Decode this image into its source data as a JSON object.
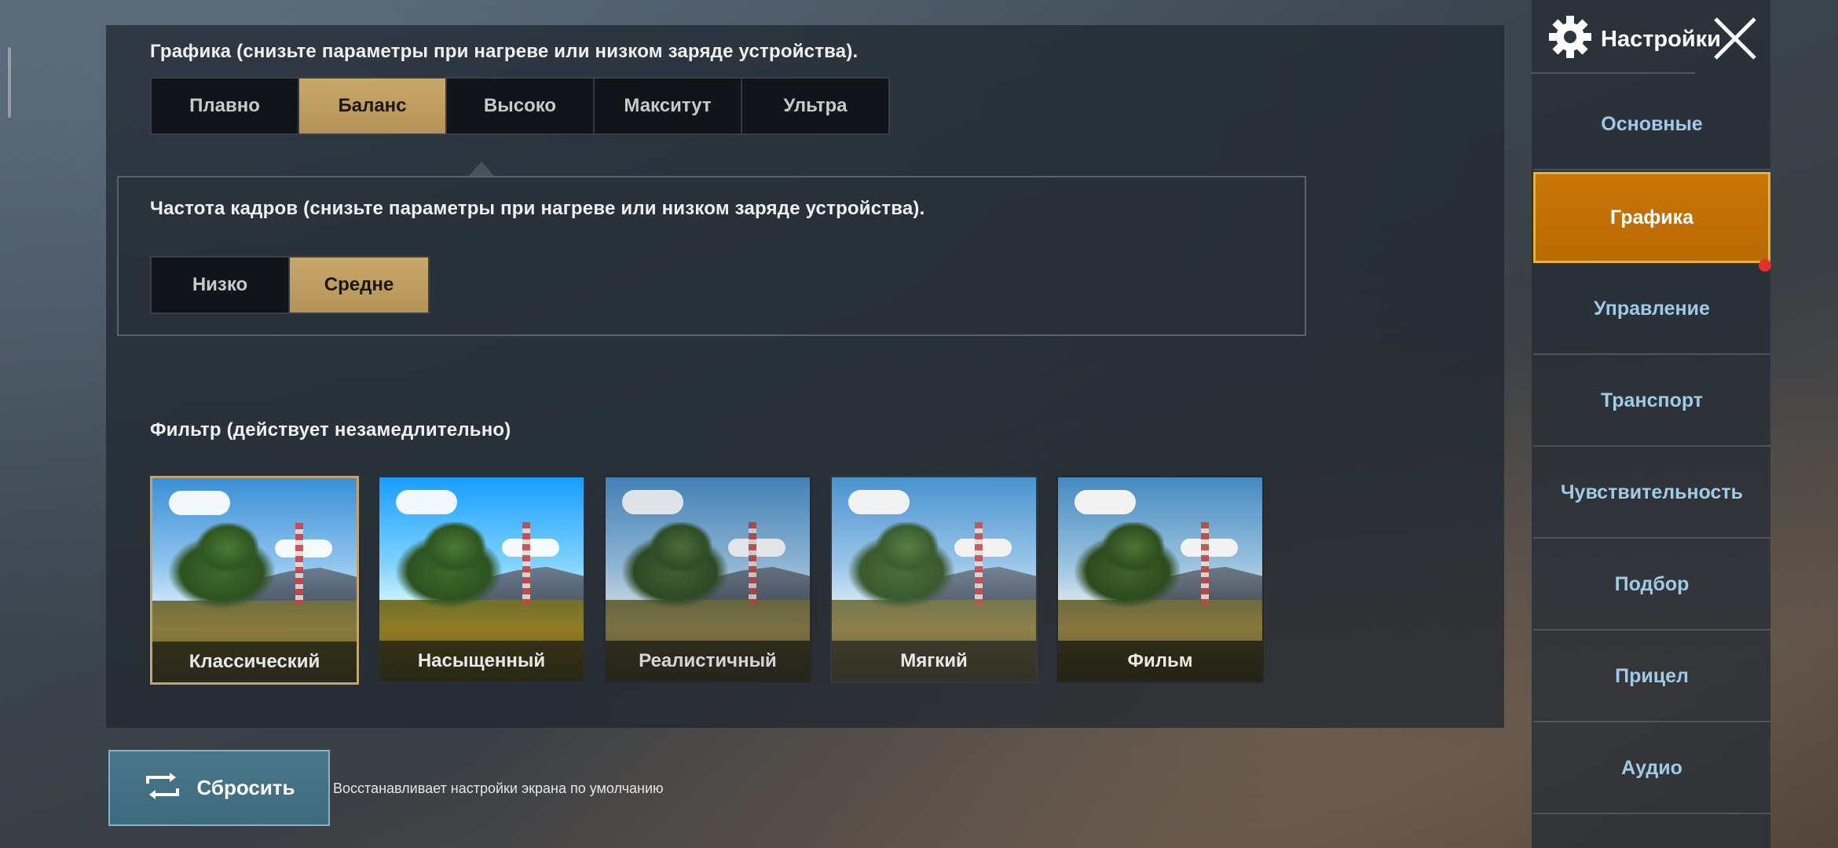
{
  "panel": {
    "graphics": {
      "title": "Графика (снизьте параметры при нагреве или низком заряде устройства).",
      "options": [
        "Плавно",
        "Баланс",
        "Высоко",
        "Макситут",
        "Ультра"
      ],
      "selected": "Баланс"
    },
    "framerate": {
      "title": "Частота кадров (снизьте параметры при нагреве или низком заряде устройства).",
      "options": [
        "Низко",
        "Средне"
      ],
      "selected": "Средне"
    },
    "filter": {
      "title": "Фильтр (действует незамедлительно)",
      "items": [
        "Классический",
        "Насыщенный",
        "Реалистичный",
        "Мягкий",
        "Фильм"
      ],
      "selected": "Классический"
    }
  },
  "reset": {
    "label": "Сбросить",
    "hint": "Восстанавливает настройки экрана по умолчанию"
  },
  "sidebar": {
    "title": "Настройки",
    "items": [
      "Основные",
      "Графика",
      "Управление",
      "Транспорт",
      "Чувствительность",
      "Подбор",
      "Прицел",
      "Аудио"
    ],
    "active": "Графика"
  },
  "colors": {
    "accent_gold": "#c8a86a",
    "active_nav_orange": "#c97606",
    "nav_text": "#9fcbe6",
    "reset_button": "#4a7689",
    "notification_dot": "#e2302a"
  },
  "icons": [
    "gear-icon",
    "close-icon",
    "reset-icon"
  ]
}
